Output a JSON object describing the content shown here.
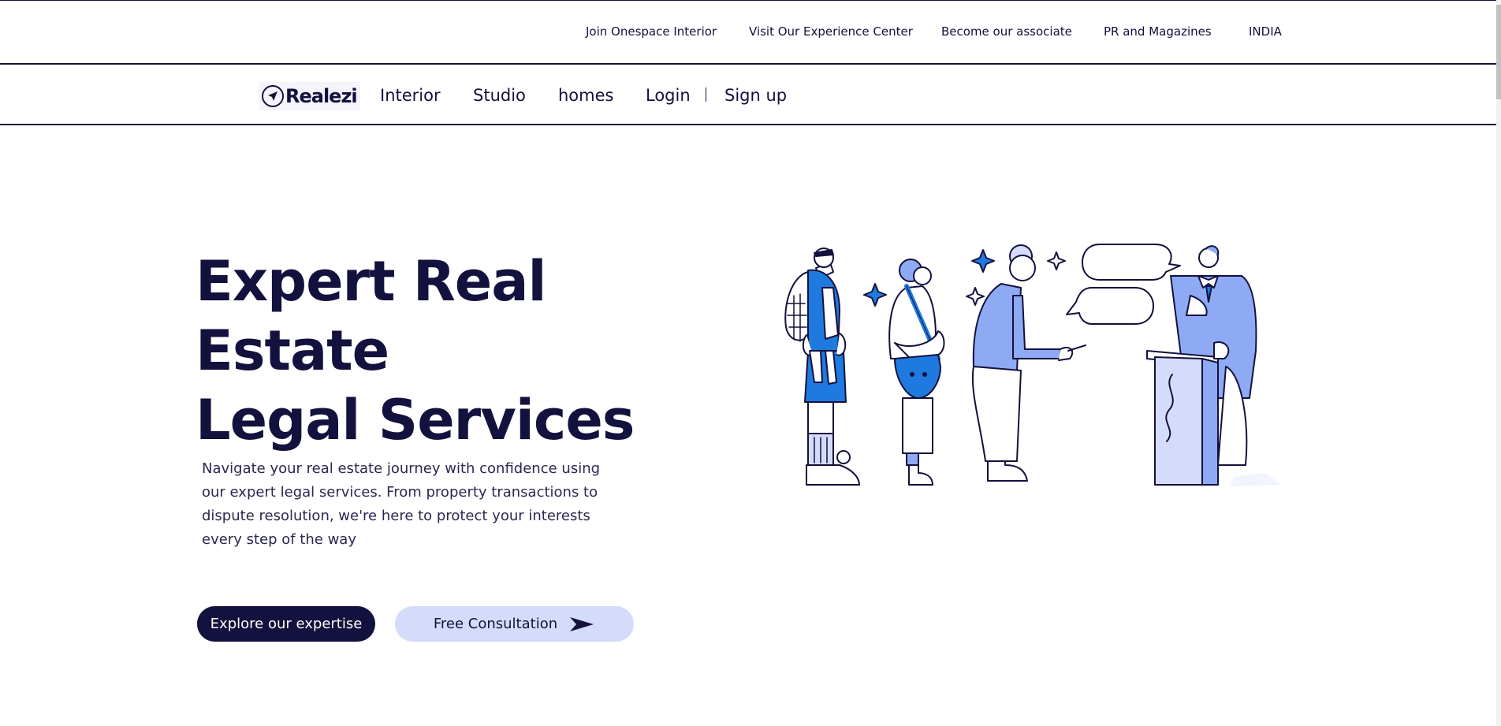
{
  "utility_nav": {
    "items": [
      {
        "label": "Join Onespace Interior"
      },
      {
        "label": "Visit Our Experience Center"
      },
      {
        "label": "Become our associate"
      },
      {
        "label": "PR and Magazines"
      },
      {
        "label": "INDIA"
      }
    ]
  },
  "main_nav": {
    "logo_text": "Realezi",
    "links": [
      {
        "label": "Interior"
      },
      {
        "label": "Studio"
      },
      {
        "label": "homes"
      },
      {
        "label": "Login"
      },
      {
        "label": "Sign up"
      }
    ]
  },
  "hero": {
    "title_line1": "Expert Real Estate",
    "title_line2": "Legal Services",
    "description": "Navigate your real estate journey with confidence using our expert legal services. From property transactions to dispute resolution, we're here to protect your interests every step of the way",
    "primary_button": "Explore our expertise",
    "secondary_button": "Free Consultation"
  },
  "colors": {
    "navy": "#13113d",
    "accent_blue": "#1f7ae0",
    "light_blue": "#8eaaf5",
    "pale_blue": "#d5dcfb"
  },
  "icons": {
    "logo": "navigation-arrow-icon",
    "consultation_arrow": "paper-plane-icon"
  }
}
